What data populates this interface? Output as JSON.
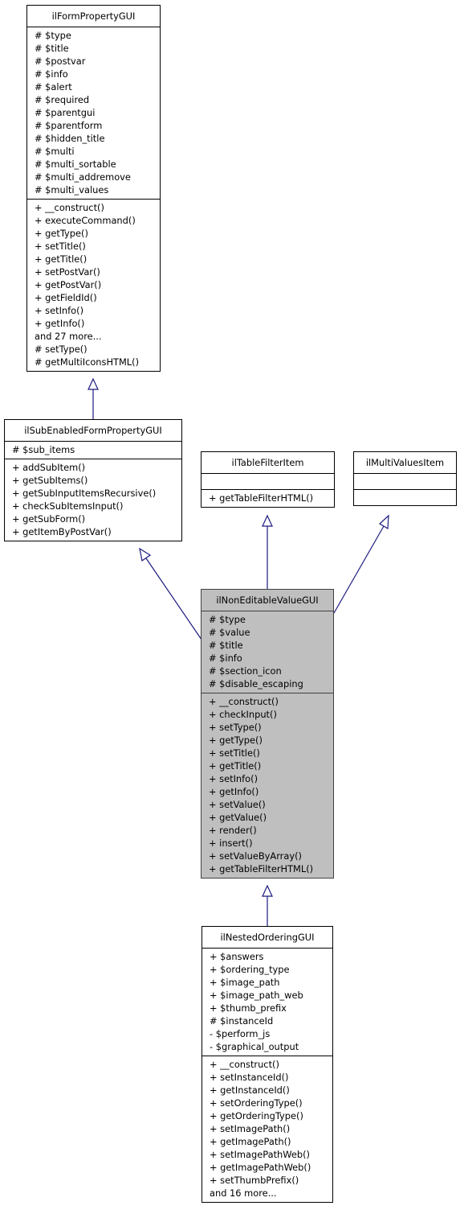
{
  "diagram": {
    "type": "uml-class-inheritance",
    "edge_color": "#1a1a7f",
    "focus_fill": "#bfbfbf",
    "classes": {
      "formProperty": {
        "name": "ilFormPropertyGUI",
        "attributes": [
          "# $type",
          "# $title",
          "# $postvar",
          "# $info",
          "# $alert",
          "# $required",
          "# $parentgui",
          "# $parentform",
          "# $hidden_title",
          "# $multi",
          "# $multi_sortable",
          "# $multi_addremove",
          "# $multi_values"
        ],
        "methods": [
          "+ __construct()",
          "+ executeCommand()",
          "+ getType()",
          "+ setTitle()",
          "+ getTitle()",
          "+ setPostVar()",
          "+ getPostVar()",
          "+ getFieldId()",
          "+ setInfo()",
          "+ getInfo()",
          "and 27 more...",
          "# setType()",
          "# getMultiIconsHTML()"
        ]
      },
      "subEnabled": {
        "name": "ilSubEnabledFormPropertyGUI",
        "attributes": [
          "# $sub_items"
        ],
        "methods": [
          "+ addSubItem()",
          "+ getSubItems()",
          "+ getSubInputItemsRecursive()",
          "+ checkSubItemsInput()",
          "+ getSubForm()",
          "+ getItemByPostVar()"
        ]
      },
      "tableFilter": {
        "name": "ilTableFilterItem",
        "attributes": [],
        "methods": [
          "+ getTableFilterHTML()"
        ]
      },
      "multiValues": {
        "name": "ilMultiValuesItem",
        "attributes": [],
        "methods": []
      },
      "nonEditable": {
        "name": "ilNonEditableValueGUI",
        "attributes": [
          "# $type",
          "# $value",
          "# $title",
          "# $info",
          "# $section_icon",
          "# $disable_escaping"
        ],
        "methods": [
          "+ __construct()",
          "+ checkInput()",
          "+ setType()",
          "+ getType()",
          "+ setTitle()",
          "+ getTitle()",
          "+ setInfo()",
          "+ getInfo()",
          "+ setValue()",
          "+ getValue()",
          "+ render()",
          "+ insert()",
          "+ setValueByArray()",
          "+ getTableFilterHTML()"
        ]
      },
      "nestedOrdering": {
        "name": "ilNestedOrderingGUI",
        "attributes": [
          "+ $answers",
          "+ $ordering_type",
          "+ $image_path",
          "+ $image_path_web",
          "+ $thumb_prefix",
          "# $instanceId",
          "- $perform_js",
          "- $graphical_output"
        ],
        "methods": [
          "+ __construct()",
          "+ setInstanceId()",
          "+ getInstanceId()",
          "+ setOrderingType()",
          "+ getOrderingType()",
          "+ setImagePath()",
          "+ getImagePath()",
          "+ setImagePathWeb()",
          "+ getImagePathWeb()",
          "+ setThumbPrefix()",
          "and 16 more..."
        ]
      }
    },
    "inheritance": [
      {
        "child": "ilSubEnabledFormPropertyGUI",
        "parent": "ilFormPropertyGUI"
      },
      {
        "child": "ilNonEditableValueGUI",
        "parent": "ilSubEnabledFormPropertyGUI"
      },
      {
        "child": "ilNonEditableValueGUI",
        "parent": "ilTableFilterItem"
      },
      {
        "child": "ilNonEditableValueGUI",
        "parent": "ilMultiValuesItem"
      },
      {
        "child": "ilNestedOrderingGUI",
        "parent": "ilNonEditableValueGUI"
      }
    ]
  }
}
